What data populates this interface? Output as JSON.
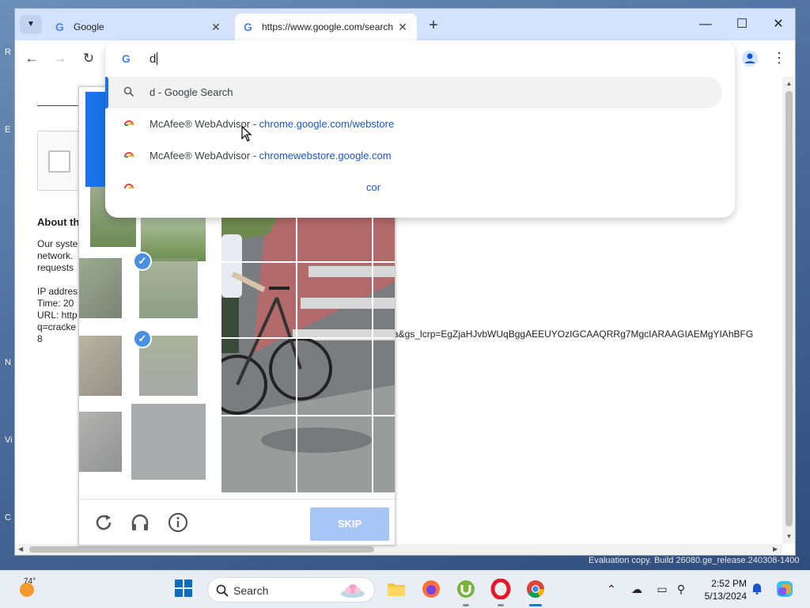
{
  "browser": {
    "tabs": [
      {
        "title": "Google",
        "active": false
      },
      {
        "title": "https://www.google.com/search",
        "active": true
      }
    ],
    "new_tab_symbol": "+",
    "window_controls": {
      "minimize": "—",
      "maximize": "☐",
      "close": "✕"
    }
  },
  "omnibox": {
    "input_value": "d",
    "suggestions": [
      {
        "type": "search",
        "text": "d - Google Search",
        "url": ""
      },
      {
        "type": "history",
        "text": "McAfee® WebAdvisor - ",
        "url": "chrome.google.com/webstore"
      },
      {
        "type": "history",
        "text": "McAfee® WebAdvisor - ",
        "url": "chromewebstore.google.com"
      },
      {
        "type": "history",
        "text": "",
        "url": "cor"
      }
    ]
  },
  "page": {
    "about_heading": "About th",
    "lines": [
      "Our syste",
      "network.",
      "requests",
      "",
      "IP addres",
      "Time: 20",
      "URL: http",
      "q=cracke",
      "8"
    ],
    "url_tail": "a&gs_lcrp=EgZjaHJvbWUqBggAEEUYOzIGCAAQRRg7MgcIARAAGIAEMgYIAhBFG"
  },
  "captcha": {
    "skip_label": "SKIP",
    "selected_tiles": 2,
    "accent": "#1a73e8"
  },
  "watermark": "Evaluation copy. Build 26080.ge_release.240308-1400",
  "taskbar": {
    "weather_temp": "74°",
    "search_label": "Search",
    "time": "2:52 PM",
    "date": "5/13/2024"
  },
  "colors": {
    "tabstrip": "#d3e3fd",
    "link": "#1a56c8",
    "skip_button": "#a8c6f5"
  }
}
